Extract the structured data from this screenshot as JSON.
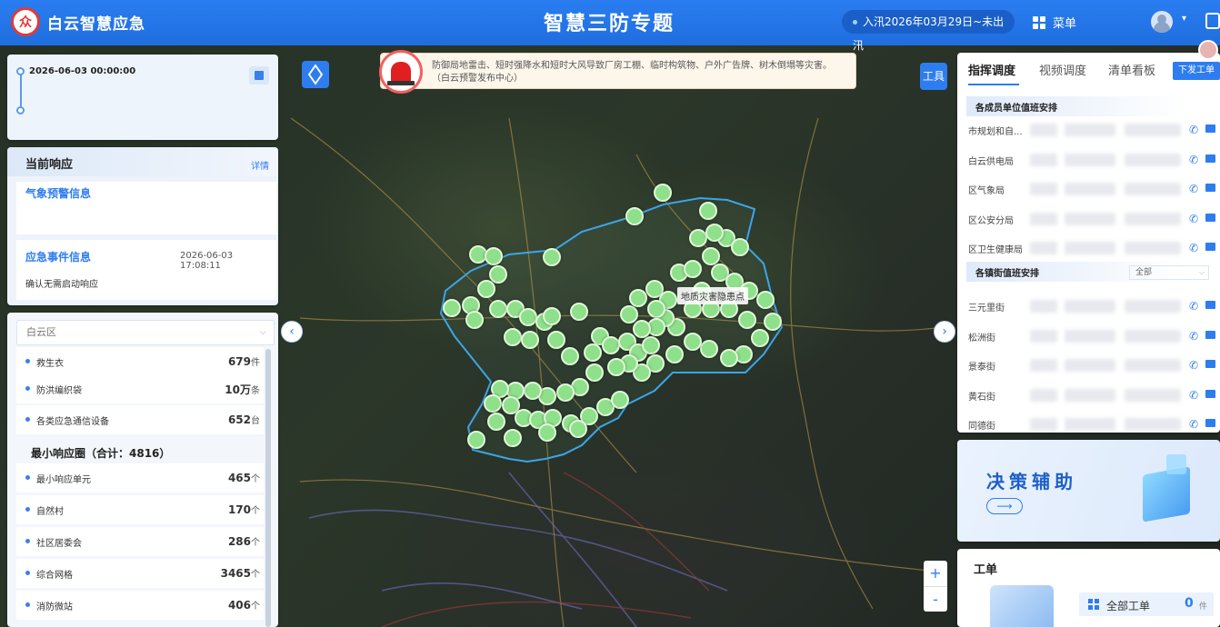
{
  "header": {
    "logo_text": "众",
    "app_name": "白云智慧应急",
    "page_title": "智慧三防专题",
    "flood_season": "入汛2026年03月29日~未出汛",
    "menu_label": "菜单"
  },
  "alert": {
    "line1": "防御局地雷击、短时强降水和短时大风导致厂房工棚、临时构筑物、户外广告牌、树木倒塌等灾害。",
    "line2": "（白云预警发布中心）"
  },
  "map": {
    "tool_label": "工具",
    "tooltip": "地质灾害隐患点",
    "marker_color": "#8ee08a",
    "boundary_color": "#3aa6e8",
    "zoom_in": "+",
    "zoom_out": "-"
  },
  "timeline": {
    "time": "2026-06-03 00:00:00"
  },
  "response": {
    "title": "当前响应",
    "detail": "详情",
    "weather_label": "气象预警信息",
    "event_label": "应急事件信息",
    "event_time": "2026-06-03 17:08:11",
    "event_note": "确认无需启动响应"
  },
  "resources": {
    "district": "白云区",
    "rows": [
      {
        "label": "救生衣",
        "value": "679",
        "unit": "件"
      },
      {
        "label": "防洪编织袋",
        "value": "10万",
        "unit": "条"
      },
      {
        "label": "各类应急通信设备",
        "value": "652",
        "unit": "台"
      }
    ],
    "min_title": "最小响应圈（合计：4816）",
    "min_rows": [
      {
        "label": "最小响应单元",
        "value": "465",
        "unit": "个"
      },
      {
        "label": "自然村",
        "value": "170",
        "unit": "个"
      },
      {
        "label": "社区居委会",
        "value": "286",
        "unit": "个"
      },
      {
        "label": "综合网格",
        "value": "3465",
        "unit": "个"
      },
      {
        "label": "消防微站",
        "value": "406",
        "unit": "个"
      }
    ]
  },
  "dispatch": {
    "tabs": [
      "指挥调度",
      "视频调度",
      "清单看板"
    ],
    "work_order_btn": "下发工单",
    "section1": "各成员单位值班安排",
    "units": [
      "市规划和自...",
      "白云供电局",
      "区气象局",
      "区公安分局",
      "区卫生健康局"
    ],
    "section2": "各镇街值班安排",
    "filter": "全部",
    "streets": [
      "三元里街",
      "松洲街",
      "景泰街",
      "黄石街",
      "同德街"
    ]
  },
  "decision": {
    "title": "决策辅助",
    "arrow": "⟶"
  },
  "workorder": {
    "title": "工单",
    "all_label": "全部工单",
    "all_value": "0",
    "unit": "件"
  }
}
